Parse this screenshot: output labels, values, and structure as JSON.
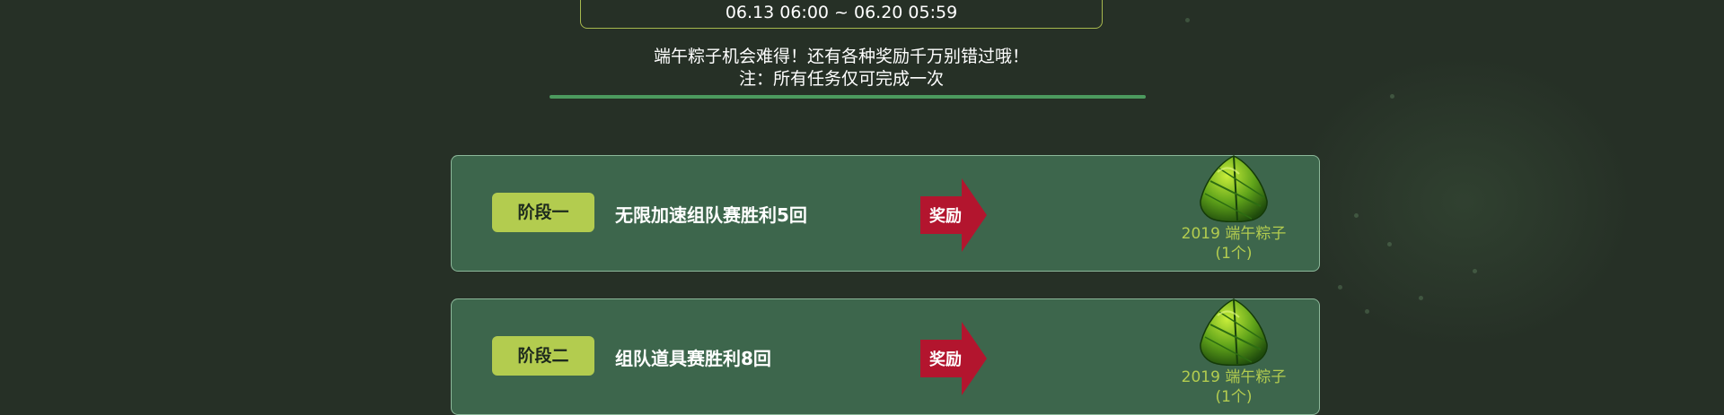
{
  "event": {
    "date_range": "06.13 06:00 ~ 06.20 05:59",
    "notice_line1": "端午粽子机会难得！还有各种奖励千万别错过哦！",
    "notice_line2": "注：所有任务仅可完成一次"
  },
  "stages": [
    {
      "badge": "阶段一",
      "task": "无限加速组队赛胜利5回",
      "reward_label": "奖励",
      "reward_icon": "zongzi-icon",
      "reward_name": "2019 端午粽子",
      "reward_qty": "(1个)"
    },
    {
      "badge": "阶段二",
      "task": "组队道具赛胜利8回",
      "reward_label": "奖励",
      "reward_icon": "zongzi-icon",
      "reward_name": "2019 端午粽子",
      "reward_qty": "(1个)"
    }
  ],
  "colors": {
    "background": "#263026",
    "card": "#3d664c",
    "badge": "#b3cc4f",
    "arrow": "#b3152e",
    "reward_text": "#b3cc4f",
    "divider": "#4c9a5e"
  }
}
